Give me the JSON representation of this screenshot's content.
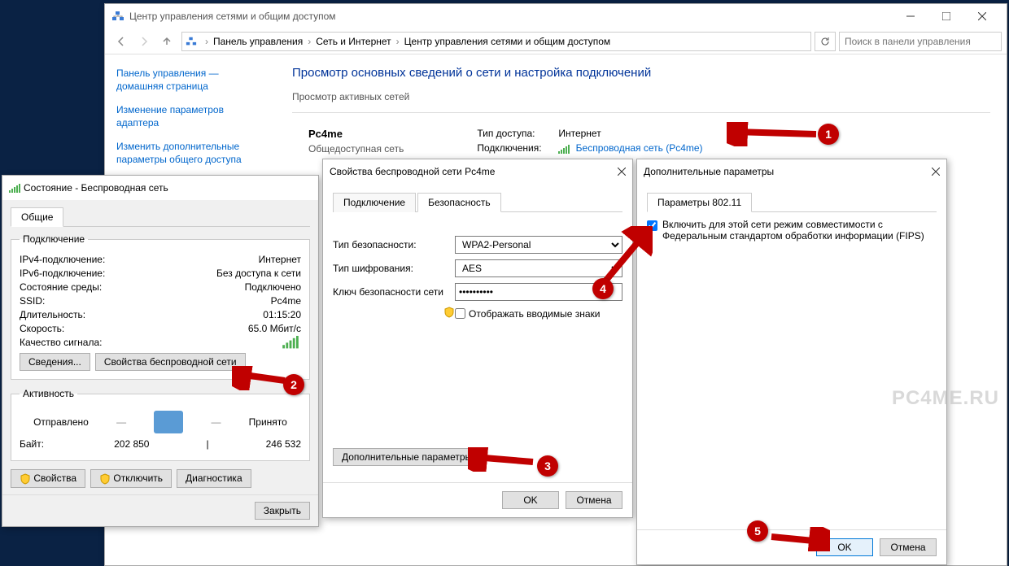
{
  "main": {
    "title": "Центр управления сетями и общим доступом",
    "breadcrumb": {
      "p1": "Панель управления",
      "p2": "Сеть и Интернет",
      "p3": "Центр управления сетями и общим доступом"
    },
    "search_placeholder": "Поиск в панели управления",
    "side": {
      "home": "Панель управления — домашняя страница",
      "adapter": "Изменение параметров адаптера",
      "sharing": "Изменить дополнительные параметры общего доступа"
    },
    "heading": "Просмотр основных сведений о сети и настройка подключений",
    "subheading": "Просмотр активных сетей",
    "network": {
      "name": "Pc4me",
      "type": "Общедоступная сеть",
      "access_lbl": "Тип доступа:",
      "access_val": "Интернет",
      "conn_lbl": "Подключения:",
      "conn_val": "Беспроводная сеть (Pc4me)"
    }
  },
  "status": {
    "title": "Состояние - Беспроводная сеть",
    "tab_general": "Общие",
    "group_conn": "Подключение",
    "rows": {
      "ipv4_l": "IPv4-подключение:",
      "ipv4_v": "Интернет",
      "ipv6_l": "IPv6-подключение:",
      "ipv6_v": "Без доступа к сети",
      "media_l": "Состояние среды:",
      "media_v": "Подключено",
      "ssid_l": "SSID:",
      "ssid_v": "Pc4me",
      "dur_l": "Длительность:",
      "dur_v": "01:15:20",
      "speed_l": "Скорость:",
      "speed_v": "65.0 Мбит/с",
      "qual_l": "Качество сигнала:"
    },
    "btn_details": "Сведения...",
    "btn_wprops": "Свойства беспроводной сети",
    "group_activity": "Активность",
    "sent_l": "Отправлено",
    "recv_l": "Принято",
    "bytes_l": "Байт:",
    "sent_v": "202 850",
    "recv_v": "246 532",
    "btn_props": "Свойства",
    "btn_disable": "Отключить",
    "btn_diag": "Диагностика",
    "btn_close": "Закрыть"
  },
  "props": {
    "title": "Свойства беспроводной сети Pc4me",
    "tab_conn": "Подключение",
    "tab_sec": "Безопасность",
    "sectype_l": "Тип безопасности:",
    "sectype_v": "WPA2-Personal",
    "enc_l": "Тип шифрования:",
    "enc_v": "AES",
    "key_l": "Ключ безопасности сети",
    "key_v": "••••••••••",
    "show_l": "Отображать вводимые знаки",
    "btn_adv": "Дополнительные параметры",
    "btn_ok": "OK",
    "btn_cancel": "Отмена"
  },
  "adv": {
    "title": "Дополнительные параметры",
    "tab": "Параметры 802.11",
    "fips": "Включить для этой сети режим совместимости с Федеральным стандартом обработки информации (FIPS)",
    "btn_ok": "OK",
    "btn_cancel": "Отмена"
  },
  "badges": {
    "b1": "1",
    "b2": "2",
    "b3": "3",
    "b4": "4",
    "b5": "5"
  },
  "watermark": "PC4ME.RU"
}
